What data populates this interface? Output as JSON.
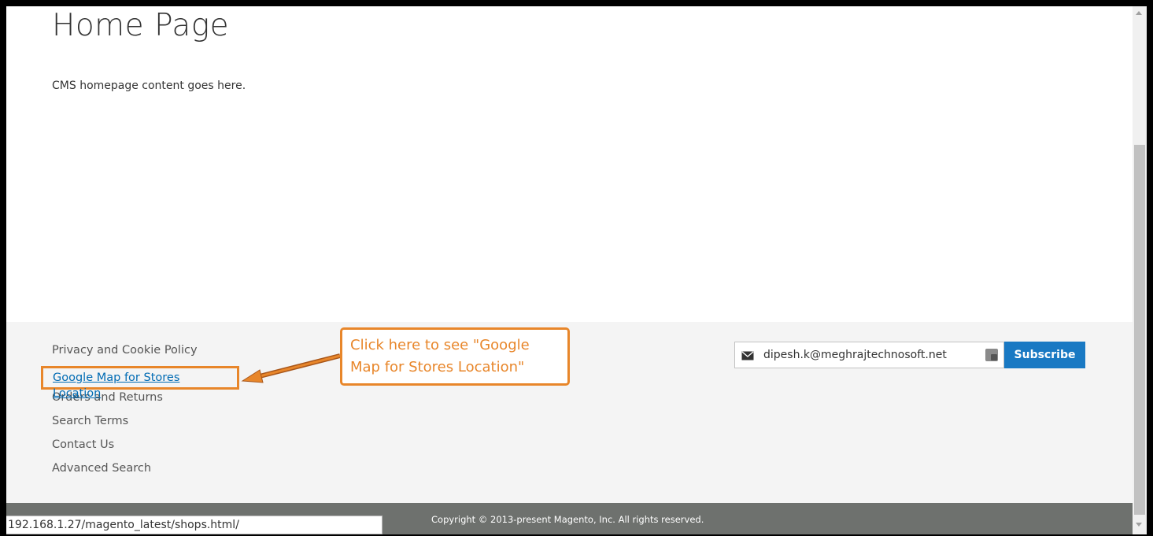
{
  "main": {
    "title": "Home Page",
    "content": "CMS homepage content goes here."
  },
  "footer": {
    "links": [
      {
        "label": "Privacy and Cookie Policy"
      },
      {
        "label": "Google Map for Stores Location"
      },
      {
        "label": "Orders and Returns"
      },
      {
        "label": "Search Terms"
      },
      {
        "label": "Contact Us"
      },
      {
        "label": "Advanced Search"
      }
    ],
    "newsletter": {
      "email_value": "dipesh.k@meghrajtechnosoft.net",
      "subscribe_label": "Subscribe"
    },
    "copyright": "Copyright © 2013-present Magento, Inc. All rights reserved."
  },
  "annotation": {
    "callout_text": "Click here to see \"Google Map for Stores Location\"",
    "color": "#e8862a"
  },
  "status_bar": {
    "url": "192.168.1.27/magento_latest/shops.html/"
  },
  "colors": {
    "primary_button": "#1979c3",
    "link": "#006bb4",
    "footer_bg": "#f4f4f4",
    "copyright_bg": "#6e716e"
  }
}
